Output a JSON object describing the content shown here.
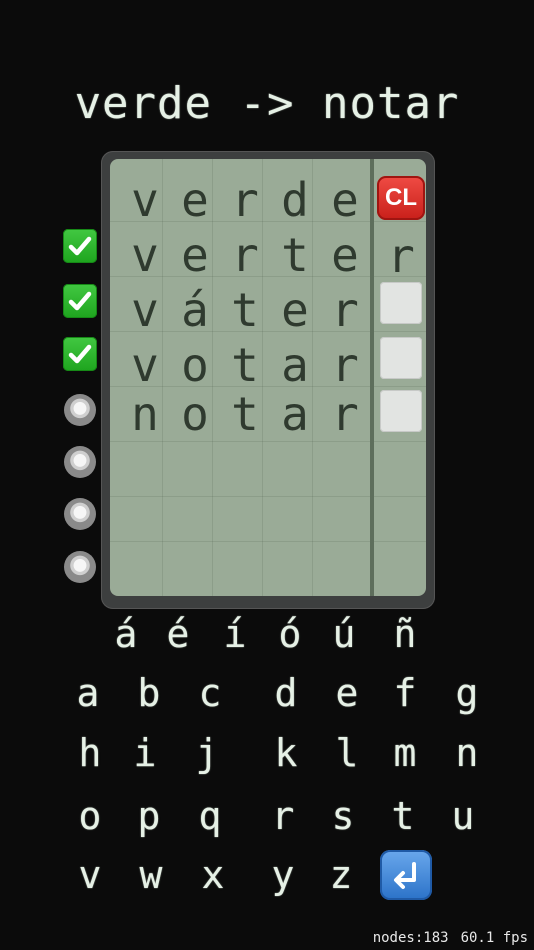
{
  "title": "verde -> notar",
  "clear_label": "CL",
  "board": {
    "start_word": [
      "v",
      "e",
      "r",
      "d",
      "e"
    ],
    "guesses": [
      {
        "letters": [
          "v",
          "e",
          "r",
          "t",
          "e",
          "r"
        ],
        "status": "check"
      },
      {
        "letters": [
          "v",
          "á",
          "t",
          "e",
          "r"
        ],
        "status": "check"
      },
      {
        "letters": [
          "v",
          "o",
          "t",
          "a",
          "r"
        ],
        "status": "check"
      },
      {
        "letters": [
          "n",
          "o",
          "t",
          "a",
          "r"
        ],
        "status": "empty"
      }
    ],
    "side_slots": [
      "r",
      "",
      "",
      ""
    ],
    "extra_status_rows": [
      "empty",
      "empty",
      "empty"
    ]
  },
  "keyboard": {
    "accent_row": [
      "á",
      "é",
      "í",
      "ó",
      "ú",
      "ñ"
    ],
    "row1": [
      "a",
      "b",
      "c",
      "d",
      "e",
      "f",
      "g"
    ],
    "row2": [
      "h",
      "i",
      "j",
      "k",
      "l",
      "m",
      "n"
    ],
    "row3": [
      "o",
      "p",
      "q",
      "r",
      "s",
      "t",
      "u"
    ],
    "row4": [
      "v",
      "w",
      "x",
      "y",
      "z"
    ],
    "enter_icon": "return-arrow-icon"
  },
  "stats": {
    "nodes": "nodes:183",
    "fps": "60.1 fps"
  },
  "colors": {
    "background": "#0b0b0b",
    "board": "#9aab97",
    "chalk": "#e6f1e6",
    "check": "#2bb52b",
    "clear_button": "#d9302a",
    "enter_key": "#3b84d6"
  }
}
